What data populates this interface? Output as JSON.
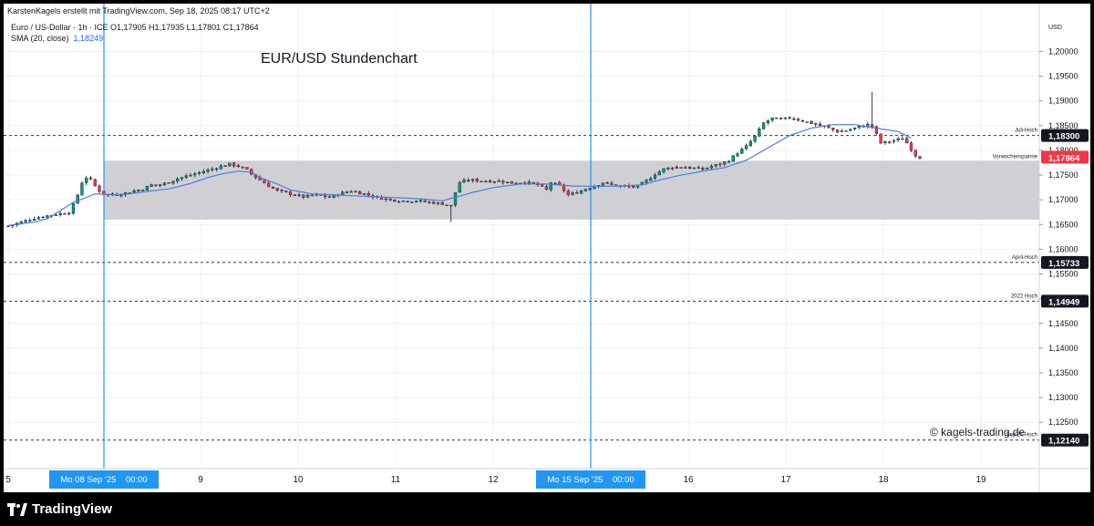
{
  "header": {
    "credit": "KarstenKagels erstellt mit TradingView.com, Sep 18, 2025 08:17 UTC+2",
    "symbol_line": "Euro / US-Dollar · 1h · ICE  O1,17905  H1,17935  L1,17801  C1,17864",
    "sma_label": "SMA (20, close)",
    "sma_value": "1,18249"
  },
  "chart_title": "EUR/USD Stundenchart",
  "watermark": "© kagels-trading.de",
  "footer": {
    "logo_text": "TradingView"
  },
  "colors": {
    "up": "#089981",
    "down": "#f23645",
    "sma": "#4a7fe0",
    "zone": "#c8c8cc",
    "vline": "#2196f3",
    "last_price": "#f23645"
  },
  "chart_data": {
    "type": "candlestick",
    "title": "EUR/USD Stundenchart",
    "currency_label": "USD",
    "y_ticks": [
      "1,20000",
      "1,19500",
      "1,19000",
      "1,18500",
      "1,18000",
      "1,17500",
      "1,17000",
      "1,16500",
      "1,16000",
      "1,15500",
      "1,15000",
      "1,14500",
      "1,14000",
      "1,13500",
      "1,13000",
      "1,12500"
    ],
    "ylim": [
      1.1208,
      1.2023
    ],
    "x_ticks": [
      {
        "label": "5",
        "x": 5
      },
      {
        "label": "9",
        "x": 9
      },
      {
        "label": "10",
        "x": 10
      },
      {
        "label": "11",
        "x": 11
      },
      {
        "label": "12",
        "x": 12
      },
      {
        "label": "16",
        "x": 16
      },
      {
        "label": "17",
        "x": 17
      },
      {
        "label": "18",
        "x": 18
      },
      {
        "label": "19",
        "x": 19
      }
    ],
    "x_markers": [
      {
        "label": "Mo 08 Sep '25    00:00",
        "x": 8
      },
      {
        "label": "Mo 15 Sep '25    00:00",
        "x": 15
      }
    ],
    "levels": [
      {
        "name": "Juli-Hoch",
        "value": 1.183,
        "label": "1,18300"
      },
      {
        "name": "April-Hoch",
        "value": 1.15733,
        "label": "1,15733"
      },
      {
        "name": "2022 Hoch",
        "value": 1.14949,
        "label": "1,14949"
      },
      {
        "name": "Sep'24-Hoch",
        "value": 1.1214,
        "label": "1,12140"
      }
    ],
    "zone": {
      "name": "Vorwochenspanne",
      "top": 1.1779,
      "bottom": 1.166
    },
    "last_price": {
      "value": 1.17864,
      "label": "1,17864"
    },
    "anchors": [
      [
        0,
        1.1647
      ],
      [
        3,
        1.1655
      ],
      [
        6,
        1.1663
      ],
      [
        9,
        1.1668
      ],
      [
        12,
        1.1672
      ],
      [
        14,
        1.1675
      ],
      [
        15,
        1.169
      ],
      [
        16,
        1.171
      ],
      [
        17,
        1.1735
      ],
      [
        18,
        1.1745
      ],
      [
        19,
        1.174
      ],
      [
        20,
        1.1728
      ],
      [
        21,
        1.1718
      ],
      [
        22,
        1.1712
      ],
      [
        24,
        1.171
      ],
      [
        26,
        1.1712
      ],
      [
        28,
        1.1716
      ],
      [
        31,
        1.1722
      ],
      [
        33,
        1.173
      ],
      [
        35,
        1.173
      ],
      [
        37,
        1.1736
      ],
      [
        39,
        1.1743
      ],
      [
        42,
        1.175
      ],
      [
        46,
        1.176
      ],
      [
        49,
        1.1768
      ],
      [
        51,
        1.1772
      ],
      [
        53,
        1.1768
      ],
      [
        55,
        1.176
      ],
      [
        56,
        1.1752
      ],
      [
        58,
        1.174
      ],
      [
        60,
        1.1728
      ],
      [
        62,
        1.1718
      ],
      [
        65,
        1.1712
      ],
      [
        68,
        1.1706
      ],
      [
        71,
        1.171
      ],
      [
        74,
        1.1705
      ],
      [
        76,
        1.1712
      ],
      [
        79,
        1.1718
      ],
      [
        82,
        1.1712
      ],
      [
        85,
        1.1705
      ],
      [
        88,
        1.17
      ],
      [
        91,
        1.1698
      ],
      [
        94,
        1.1698
      ],
      [
        97,
        1.1695
      ],
      [
        100,
        1.1692
      ],
      [
        102,
        1.1688
      ],
      [
        103,
        1.1715
      ],
      [
        104,
        1.1735
      ],
      [
        106,
        1.174
      ],
      [
        110,
        1.1738
      ],
      [
        113,
        1.1738
      ],
      [
        116,
        1.1734
      ],
      [
        119,
        1.1736
      ],
      [
        122,
        1.173
      ],
      [
        124,
        1.172
      ],
      [
        125,
        1.1735
      ],
      [
        127,
        1.1728
      ],
      [
        129,
        1.171
      ],
      [
        131,
        1.1715
      ],
      [
        133,
        1.1722
      ],
      [
        135,
        1.1728
      ],
      [
        137,
        1.1735
      ],
      [
        139,
        1.173
      ],
      [
        141,
        1.1728
      ],
      [
        143,
        1.1726
      ],
      [
        145,
        1.1728
      ],
      [
        147,
        1.1738
      ],
      [
        149,
        1.1752
      ],
      [
        151,
        1.1762
      ],
      [
        153,
        1.1766
      ],
      [
        156,
        1.1766
      ],
      [
        158,
        1.1764
      ],
      [
        160,
        1.1762
      ],
      [
        162,
        1.1768
      ],
      [
        164,
        1.1772
      ],
      [
        166,
        1.178
      ],
      [
        168,
        1.1795
      ],
      [
        170,
        1.1808
      ],
      [
        172,
        1.1828
      ],
      [
        174,
        1.1855
      ],
      [
        176,
        1.1865
      ],
      [
        178,
        1.1862
      ],
      [
        180,
        1.1866
      ],
      [
        182,
        1.1862
      ],
      [
        185,
        1.1855
      ],
      [
        187,
        1.185
      ],
      [
        189,
        1.1845
      ],
      [
        191,
        1.1838
      ],
      [
        193,
        1.184
      ],
      [
        195,
        1.1845
      ],
      [
        197,
        1.185
      ],
      [
        198,
        1.1852
      ],
      [
        199,
        1.1848
      ],
      [
        200,
        1.1832
      ],
      [
        201,
        1.1815
      ],
      [
        203,
        1.1818
      ],
      [
        205,
        1.1822
      ],
      [
        206,
        1.1825
      ],
      [
        207,
        1.1815
      ],
      [
        208,
        1.1802
      ],
      [
        209,
        1.179
      ],
      [
        210,
        1.1786
      ]
    ],
    "sma_anchors": [
      [
        0,
        1.1648
      ],
      [
        6,
        1.1655
      ],
      [
        9,
        1.1662
      ],
      [
        12,
        1.1678
      ],
      [
        15,
        1.1695
      ],
      [
        18,
        1.1705
      ],
      [
        20,
        1.1712
      ],
      [
        24,
        1.171
      ],
      [
        28,
        1.1712
      ],
      [
        33,
        1.1718
      ],
      [
        37,
        1.1722
      ],
      [
        42,
        1.1733
      ],
      [
        46,
        1.1745
      ],
      [
        49,
        1.1752
      ],
      [
        53,
        1.1758
      ],
      [
        56,
        1.1756
      ],
      [
        58,
        1.1745
      ],
      [
        62,
        1.1732
      ],
      [
        65,
        1.172
      ],
      [
        70,
        1.1712
      ],
      [
        75,
        1.171
      ],
      [
        80,
        1.1708
      ],
      [
        85,
        1.1706
      ],
      [
        90,
        1.1704
      ],
      [
        95,
        1.1702
      ],
      [
        100,
        1.1698
      ],
      [
        103,
        1.1705
      ],
      [
        107,
        1.1715
      ],
      [
        112,
        1.1725
      ],
      [
        118,
        1.1732
      ],
      [
        124,
        1.1732
      ],
      [
        130,
        1.1728
      ],
      [
        136,
        1.1727
      ],
      [
        141,
        1.1728
      ],
      [
        146,
        1.173
      ],
      [
        150,
        1.174
      ],
      [
        155,
        1.175
      ],
      [
        160,
        1.1758
      ],
      [
        165,
        1.1765
      ],
      [
        170,
        1.178
      ],
      [
        175,
        1.1805
      ],
      [
        180,
        1.183
      ],
      [
        185,
        1.1845
      ],
      [
        190,
        1.1852
      ],
      [
        195,
        1.1852
      ],
      [
        200,
        1.1845
      ],
      [
        205,
        1.1838
      ],
      [
        208,
        1.1825
      ]
    ],
    "spike": {
      "index": 199,
      "high": 1.1918
    },
    "dip": {
      "index": 102,
      "low": 1.1655
    }
  }
}
